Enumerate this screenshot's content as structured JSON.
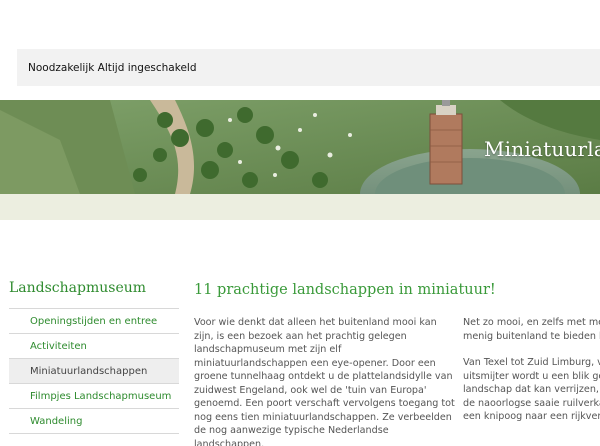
{
  "cookie_bar": {
    "text": "Noodzakelijk Altijd ingeschakeld"
  },
  "banner": {
    "title": "Miniatuurland"
  },
  "sidebar": {
    "title": "Landschapmuseum",
    "items": [
      {
        "label": "Openingstijden en entree"
      },
      {
        "label": "Activiteiten"
      },
      {
        "label": "Miniatuurlandschappen"
      },
      {
        "label": "Filmpjes Landschapmuseum"
      },
      {
        "label": "Wandeling"
      }
    ],
    "active_index": 2
  },
  "content": {
    "heading": "11 prachtige landschappen in miniatuur!",
    "col1": [
      "Voor wie denkt dat alleen het buitenland mooi kan zijn, is een bezoek aan het prachtig gelegen landschapmuseum met zijn elf miniatuurlandschappen een eye-opener. Door een groene tunnelhaag ontdekt u de plattelandsidylle van zuidwest Engeland, ook wel de 'tuin van Europa' genoemd. Een poort verschaft vervolgens toegang tot nog eens tien miniatuurlandschappen. Ze verbeelden de nog aanwezige typische Nederlandse landschappen."
    ],
    "col2": [
      [
        "Net zo mooi, en zelfs met meer",
        "menig buitenland te bieden he"
      ],
      [
        "Van Texel tot Zuid Limburg, van",
        "uitsmijter wordt u een blik gegu",
        "landschap dat kan verrijzen, hoe",
        "de naoorlogse saaie ruilverkavel",
        "een knipoog naar een rijkverle"
      ]
    ]
  }
}
